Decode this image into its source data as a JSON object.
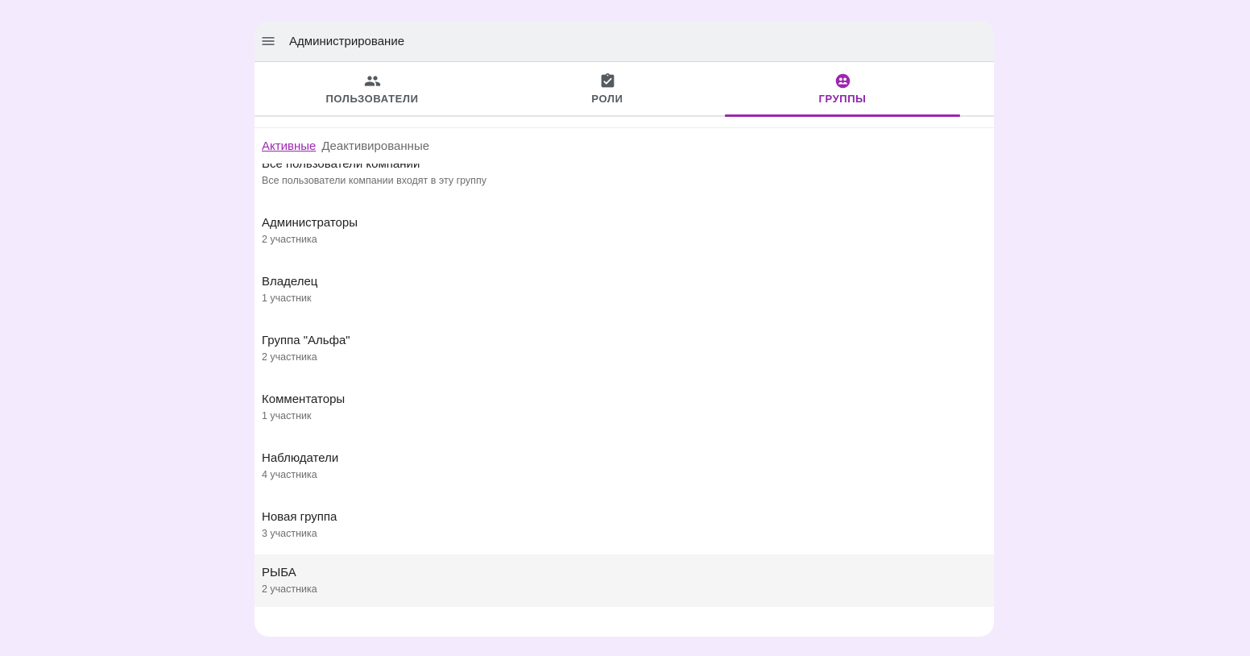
{
  "appbar": {
    "menu_icon": "menu-icon",
    "title": "Администрирование"
  },
  "tabs": [
    {
      "label": "ПОЛЬЗОВАТЕЛИ",
      "icon": "people-icon",
      "active": false
    },
    {
      "label": "РОЛИ",
      "icon": "clipboard-check-icon",
      "active": false
    },
    {
      "label": "ГРУППЫ",
      "icon": "groups-icon",
      "active": true
    }
  ],
  "filters": {
    "active": "Активные",
    "inactive": "Деактивированные"
  },
  "groups": [
    {
      "title": "Все пользователи компании",
      "subtitle": "Все пользователи компании входят в эту группу"
    },
    {
      "title": "Администраторы",
      "subtitle": "2 участника"
    },
    {
      "title": "Владелец",
      "subtitle": "1 участник"
    },
    {
      "title": "Группа \"Альфа\"",
      "subtitle": "2 участника"
    },
    {
      "title": "Комментаторы",
      "subtitle": "1 участник"
    },
    {
      "title": "Наблюдатели",
      "subtitle": "4 участника"
    },
    {
      "title": "Новая группа",
      "subtitle": "3 участника"
    },
    {
      "title": "РЫБА",
      "subtitle": "2 участника"
    }
  ],
  "colors": {
    "accent": "#9c27b0",
    "background": "#f4eafd"
  }
}
